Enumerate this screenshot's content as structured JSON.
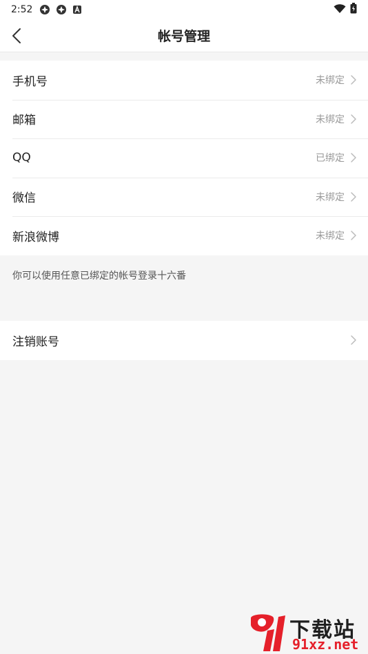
{
  "status_bar": {
    "time": "2:52"
  },
  "nav": {
    "title": "帐号管理"
  },
  "accounts": [
    {
      "label": "手机号",
      "status": "未绑定"
    },
    {
      "label": "邮箱",
      "status": "未绑定"
    },
    {
      "label": "QQ",
      "status": "已绑定"
    },
    {
      "label": "微信",
      "status": "未绑定"
    },
    {
      "label": "新浪微博",
      "status": "未绑定"
    }
  ],
  "hint": "你可以使用任意已绑定的帐号登录十六番",
  "cancel_account": {
    "label": "注销账号"
  },
  "watermark": {
    "logo_digits": "91",
    "text": "下载站",
    "url": "91xz.net"
  },
  "colors": {
    "background": "#f5f5f5",
    "card": "#ffffff",
    "status_text": "#999999",
    "watermark_red": "#e5202a"
  }
}
